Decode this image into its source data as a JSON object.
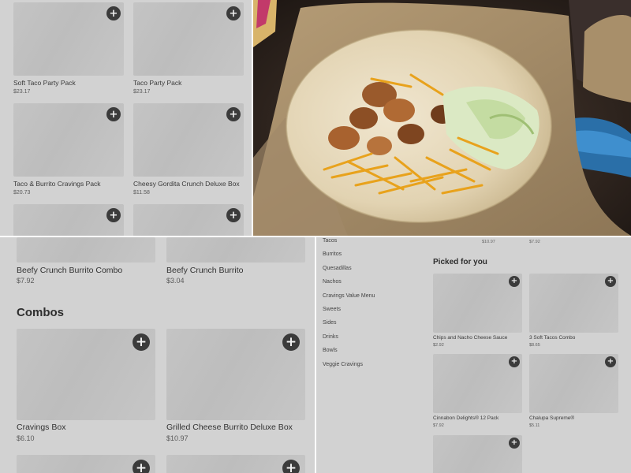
{
  "top_left": {
    "items": [
      {
        "name": "Soft Taco Party Pack",
        "price": "$23.17",
        "add": "+"
      },
      {
        "name": "Taco Party Pack",
        "price": "$23.17",
        "add": "+"
      },
      {
        "name": "Taco & Burrito Cravings Pack",
        "price": "$20.73",
        "add": "+"
      },
      {
        "name": "Cheesy Gordita Crunch Deluxe Box",
        "price": "$11.58",
        "add": "+"
      },
      {
        "name": "",
        "price": "",
        "add": "+"
      },
      {
        "name": "",
        "price": "",
        "add": "+"
      }
    ]
  },
  "bottom_left": {
    "items": [
      {
        "name": "Beefy Crunch Burrito Combo",
        "price": "$7.92"
      },
      {
        "name": "Beefy Crunch Burrito",
        "price": "$3.04"
      }
    ],
    "section_title": "Combos",
    "combos": [
      {
        "name": "Cravings Box",
        "price": "$6.10",
        "add": "+"
      },
      {
        "name": "Grilled Cheese Burrito Deluxe Box",
        "price": "$10.97",
        "add": "+"
      },
      {
        "name": "",
        "price": "",
        "add": "+"
      },
      {
        "name": "",
        "price": "",
        "add": "+"
      }
    ]
  },
  "bottom_right": {
    "top_prices": [
      "$10.97",
      "$7.92"
    ],
    "categories": [
      "Tacos",
      "Burritos",
      "Quesadillas",
      "Nachos",
      "Cravings Value Menu",
      "Sweets",
      "Sides",
      "Drinks",
      "Bowls",
      "Veggie Cravings"
    ],
    "picked_title": "Picked for you",
    "picked": [
      {
        "name": "Chips and Nacho Cheese Sauce",
        "price": "$2.92",
        "add": "+"
      },
      {
        "name": "3 Soft Tacos Combo",
        "price": "$8.65",
        "add": "+"
      },
      {
        "name": "Cinnabon Delights® 12 Pack",
        "price": "$7.92",
        "add": "+"
      },
      {
        "name": "Chalupa Supreme®",
        "price": "$5.11",
        "add": "+"
      },
      {
        "name": "",
        "price": "",
        "add": "+"
      }
    ]
  },
  "colors": {
    "panel_bg": "#d2d2d2",
    "thumb": "#c2c2c2",
    "add_button": "#3b3b3b",
    "tortilla": "#e8dcc0",
    "cheese": "#e8a21c",
    "lettuce": "#d6e6bc"
  },
  "icons": [
    "plus-icon"
  ]
}
